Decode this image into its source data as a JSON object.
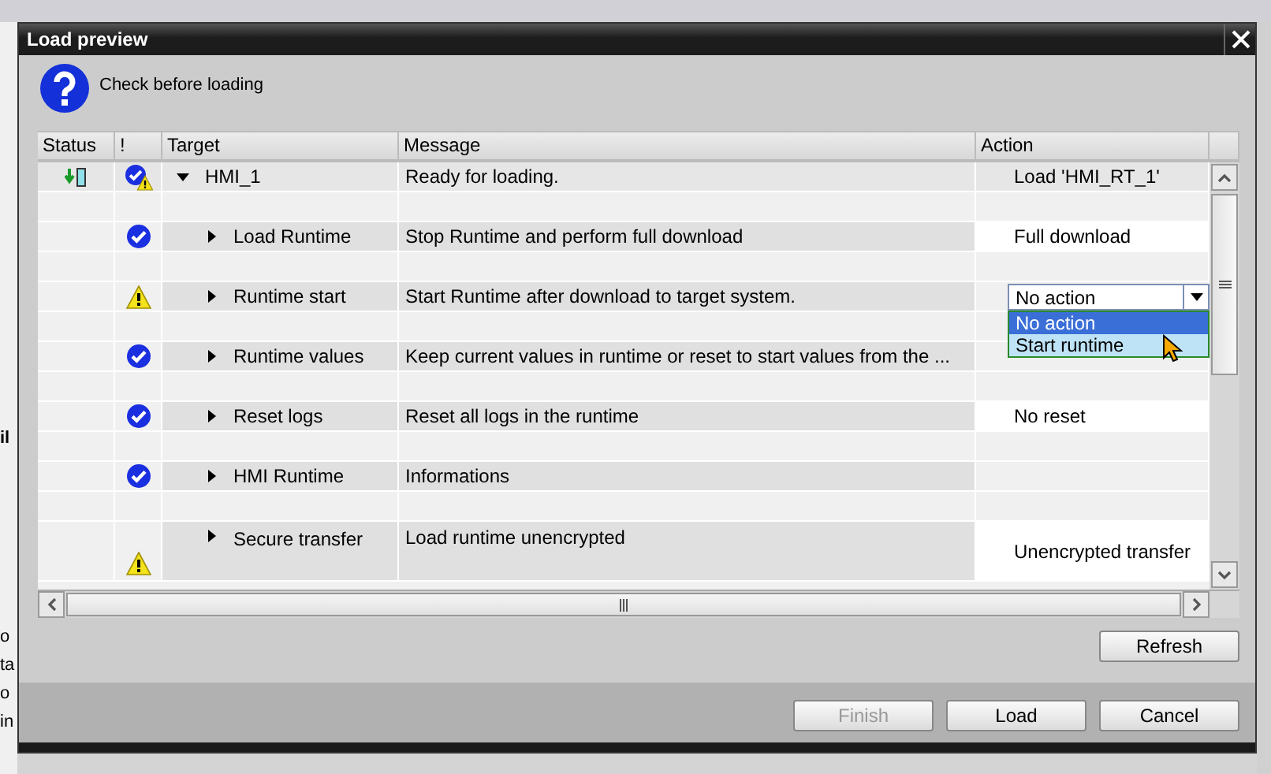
{
  "background": {
    "fragments": [
      "il",
      "o",
      "ta",
      "o",
      "in"
    ]
  },
  "window": {
    "title": "Load preview"
  },
  "header": {
    "text": "Check before loading"
  },
  "table": {
    "columns": [
      "Status",
      "!",
      "Target",
      "Message",
      "Action"
    ],
    "rows": [
      {
        "target": "HMI_1",
        "message": "Ready for loading.",
        "loadable": true,
        "ok": true,
        "warning": true,
        "expanded": true,
        "action": {
          "kind": "text",
          "value": "Load 'HMI_RT_1'"
        },
        "children": [
          {
            "target": "Load Runtime",
            "message": "Stop Runtime and perform full download",
            "ok": true,
            "warning": false,
            "expanded": false,
            "action": {
              "kind": "text",
              "value": "Full download"
            }
          },
          {
            "target": "Runtime start",
            "message": "Start Runtime after download to target system.",
            "ok": false,
            "warning": true,
            "expanded": false,
            "action": {
              "kind": "dropdown",
              "value": "No action",
              "open": true,
              "options": [
                {
                  "label": "No action",
                  "selected": true
                },
                {
                  "label": "Start runtime",
                  "selected": false
                }
              ]
            }
          },
          {
            "target": "Runtime values",
            "message": "Keep current values in runtime or reset to start values from the ...",
            "ok": true,
            "warning": false,
            "expanded": false
          },
          {
            "target": "Reset logs",
            "message": "Reset all logs in the runtime",
            "ok": true,
            "warning": false,
            "expanded": false,
            "action": {
              "kind": "text",
              "value": "No reset"
            }
          },
          {
            "target": "HMI Runtime",
            "message": "Informations",
            "ok": true,
            "warning": false,
            "expanded": false
          },
          {
            "target": "Secure transfer",
            "message": "Load runtime unencrypted",
            "ok": false,
            "warning": true,
            "expanded": false,
            "action": {
              "kind": "text",
              "value": "Unencrypted transfer"
            }
          }
        ]
      }
    ]
  },
  "refresh_button": {
    "label": "Refresh"
  },
  "footer_buttons": [
    {
      "label": "Finish",
      "disabled": true
    },
    {
      "label": "Load",
      "disabled": false
    },
    {
      "label": "Cancel",
      "disabled": false
    }
  ]
}
